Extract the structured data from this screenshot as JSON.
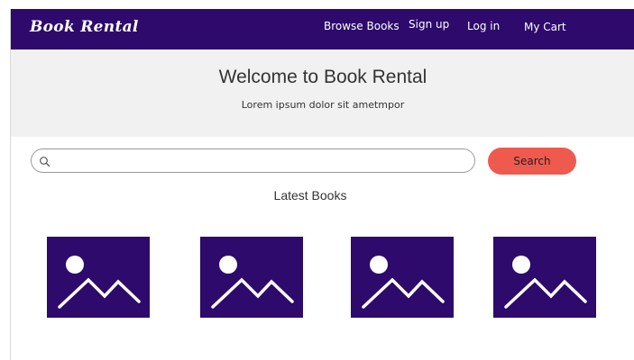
{
  "brand": {
    "name": "Book Rental"
  },
  "nav": {
    "items": [
      {
        "label": "Browse Books"
      },
      {
        "label": "Sign up"
      },
      {
        "label": "Log in"
      },
      {
        "label": "My Cart"
      }
    ]
  },
  "hero": {
    "title": "Welcome to Book Rental",
    "subtitle": "Lorem ipsum dolor sit ametmpor"
  },
  "search": {
    "placeholder": "",
    "value": "",
    "button_label": "Search",
    "icon": "search-icon"
  },
  "latest": {
    "title": "Latest Books",
    "books": [
      {
        "image_icon": "image-placeholder-icon"
      },
      {
        "image_icon": "image-placeholder-icon"
      },
      {
        "image_icon": "image-placeholder-icon"
      },
      {
        "image_icon": "image-placeholder-icon"
      }
    ]
  },
  "colors": {
    "primary": "#2d0a6b",
    "accent": "#ef5a4f",
    "hero_bg": "#f1f1f1"
  }
}
